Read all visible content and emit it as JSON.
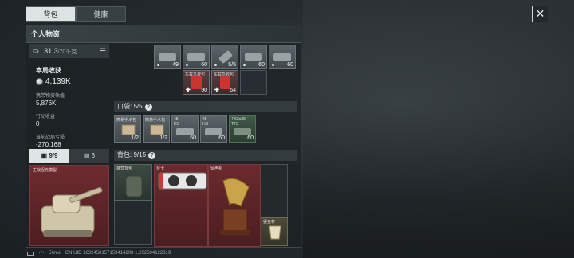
{
  "tabs": [
    {
      "label": "背包",
      "active": true
    },
    {
      "label": "健康",
      "active": false
    }
  ],
  "close_icon": "close-icon",
  "panel": {
    "title": "个人物资",
    "weight": {
      "current": "31.3",
      "max": "/70千克"
    },
    "income_title": "本局收获",
    "income_value": "4,139K",
    "stats": [
      {
        "label": "携带物资估值",
        "value": "5,876K"
      },
      {
        "label": "行动收益",
        "value": "0"
      },
      {
        "label": "当前战局亏损",
        "value": "-270,168"
      }
    ],
    "lower_tabs": [
      {
        "label": "9/9",
        "active": true
      },
      {
        "label": "3",
        "active": false
      }
    ],
    "model_label": "主战坦克模型"
  },
  "top_items": {
    "row1_counts": [
      "49",
      "60",
      "5/5",
      "60",
      "60"
    ],
    "row2": [
      {
        "tag": "车载急救包",
        "count": "90"
      },
      {
        "tag": "车载急救包",
        "count": "64"
      }
    ]
  },
  "pouch": {
    "label": "口袋: 5/5",
    "help": "?",
    "items": [
      {
        "tag": "简易手术包",
        "count": "1/2"
      },
      {
        "tag": "简易手术包",
        "count": "1/2"
      },
      {
        "tag": "45",
        "tag2": "HS",
        "count": "60"
      },
      {
        "tag": "45",
        "tag2": "HS",
        "count": "60"
      },
      {
        "tag": "7.62x39",
        "tag2": "T2S",
        "count": "60"
      }
    ]
  },
  "backpack": {
    "label": "背包: 9/15",
    "help": "?",
    "items": [
      {
        "tag": "露营背包"
      },
      {
        "tag": "显卡"
      },
      {
        "tag": "留声机"
      },
      {
        "tag": "鎏金杯"
      }
    ]
  },
  "footer": {
    "ping": "56ms",
    "uid": "CN UID 1832458157159414208 1,202504122319"
  }
}
